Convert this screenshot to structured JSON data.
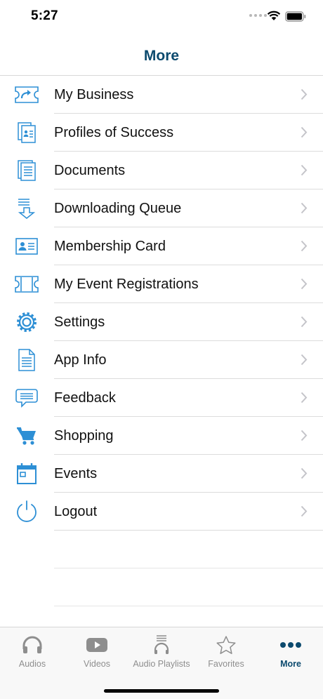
{
  "status_bar": {
    "time": "5:27"
  },
  "nav": {
    "title": "More"
  },
  "menu": [
    {
      "label": "My Business",
      "icon": "ticket-arrow-icon"
    },
    {
      "label": "Profiles of Success",
      "icon": "profile-documents-icon"
    },
    {
      "label": "Documents",
      "icon": "documents-icon"
    },
    {
      "label": "Downloading Queue",
      "icon": "download-queue-icon"
    },
    {
      "label": "Membership Card",
      "icon": "membership-card-icon"
    },
    {
      "label": "My Event Registrations",
      "icon": "ticket-icon"
    },
    {
      "label": "Settings",
      "icon": "gear-icon"
    },
    {
      "label": "App Info",
      "icon": "document-icon"
    },
    {
      "label": "Feedback",
      "icon": "chat-bubble-icon"
    },
    {
      "label": "Shopping",
      "icon": "cart-icon"
    },
    {
      "label": "Events",
      "icon": "calendar-icon"
    },
    {
      "label": "Logout",
      "icon": "power-icon"
    }
  ],
  "tabs": [
    {
      "label": "Audios",
      "icon": "headphones-icon"
    },
    {
      "label": "Videos",
      "icon": "video-play-icon"
    },
    {
      "label": "Audio Playlists",
      "icon": "playlist-icon"
    },
    {
      "label": "Favorites",
      "icon": "star-icon"
    },
    {
      "label": "More",
      "icon": "more-dots-icon",
      "active": true
    }
  ],
  "colors": {
    "accent": "#0c4a6e",
    "icon_blue": "#2d8fd5",
    "inactive": "#8e8e8e"
  }
}
